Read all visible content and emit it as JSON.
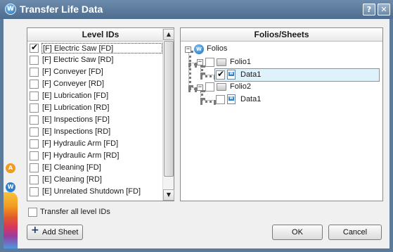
{
  "window": {
    "title": "Transfer Life Data",
    "logo_icon": "weibull-logo-icon",
    "help_label": "?",
    "close_label": "✕"
  },
  "left_panel": {
    "header": "Level IDs",
    "items": [
      {
        "label": "[F] Electric Saw [FD]",
        "checked": true,
        "selected": true
      },
      {
        "label": "[F] Electric Saw [RD]",
        "checked": false
      },
      {
        "label": "[F] Conveyer [FD]",
        "checked": false
      },
      {
        "label": "[F] Conveyer [RD]",
        "checked": false
      },
      {
        "label": "[E] Lubrication [FD]",
        "checked": false
      },
      {
        "label": "[E] Lubrication [RD]",
        "checked": false
      },
      {
        "label": "[E] Inspections [FD]",
        "checked": false
      },
      {
        "label": "[E] Inspections [RD]",
        "checked": false
      },
      {
        "label": "[F] Hydraulic Arm [FD]",
        "checked": false
      },
      {
        "label": "[F] Hydraulic Arm [RD]",
        "checked": false
      },
      {
        "label": "[E] Cleaning [FD]",
        "checked": false
      },
      {
        "label": "[E] Cleaning [RD]",
        "checked": false
      },
      {
        "label": "[E] Unrelated Shutdown [FD]",
        "checked": false
      }
    ]
  },
  "right_panel": {
    "header": "Folios/Sheets",
    "tree": {
      "root_label": "Folios",
      "folio1_label": "Folio1",
      "folio1_sheet_label": "Data1",
      "folio2_label": "Folio2",
      "folio2_sheet_label": "Data1"
    }
  },
  "footer": {
    "transfer_all_label": "Transfer all level IDs",
    "add_sheet_label": "Add Sheet",
    "ok_label": "OK",
    "cancel_label": "Cancel"
  }
}
